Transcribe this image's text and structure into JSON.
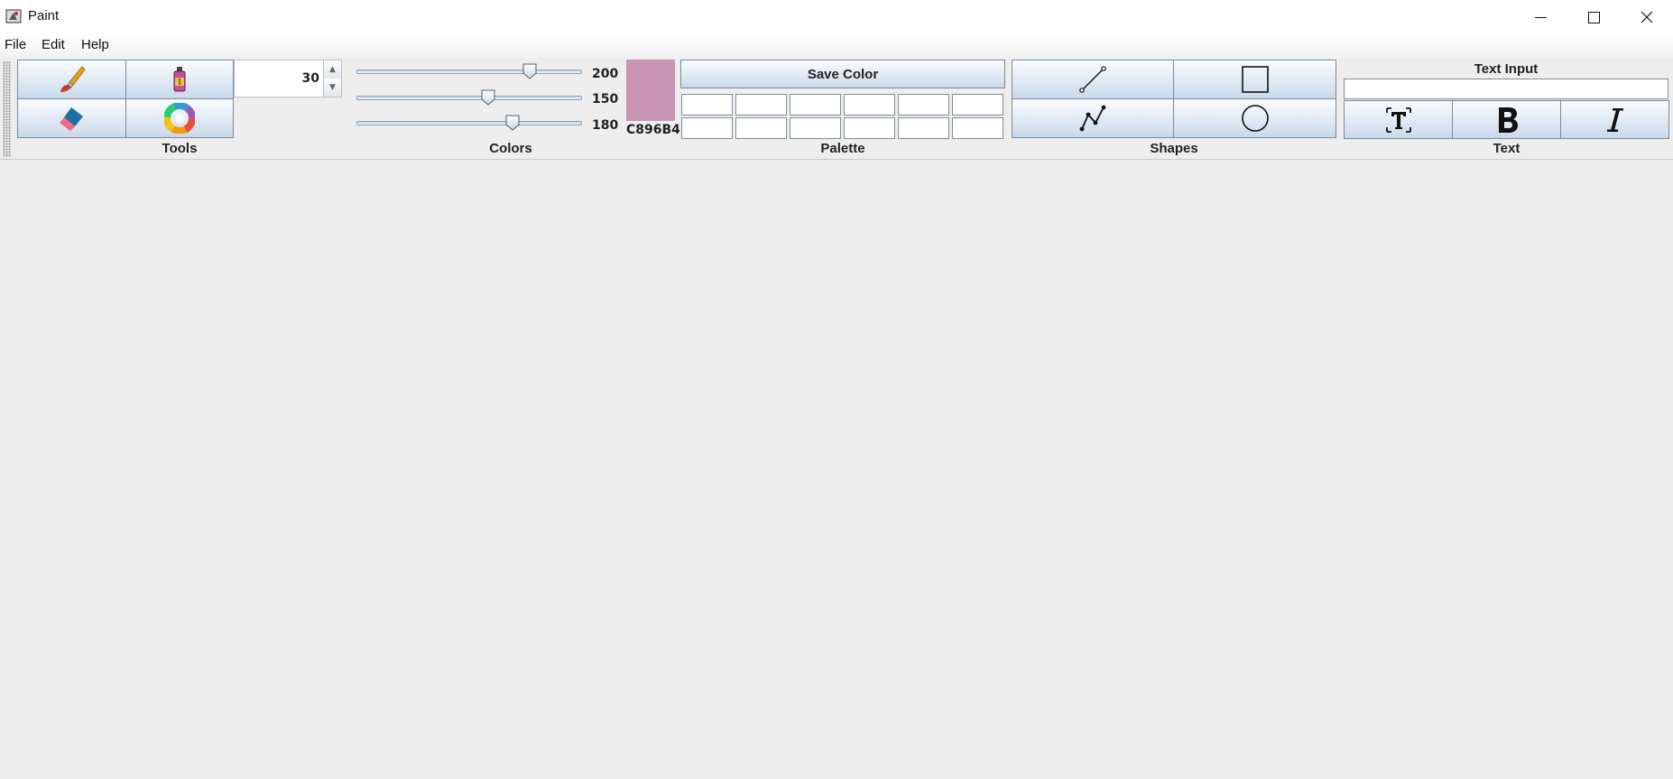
{
  "window": {
    "title": "Paint"
  },
  "menu": {
    "items": [
      "File",
      "Edit",
      "Help"
    ]
  },
  "tools": {
    "label": "Tools",
    "buttons": [
      "brush-icon",
      "spray-can-icon",
      "eraser-icon",
      "color-wheel-icon"
    ],
    "size_value": "30"
  },
  "colors": {
    "label": "Colors",
    "red": 200,
    "green": 150,
    "blue": 180,
    "slider_max": 255,
    "current_hex": "C896B4",
    "current_color": "#C896B4"
  },
  "palette": {
    "label": "Palette",
    "save_label": "Save Color",
    "cells": 12
  },
  "shapes": {
    "label": "Shapes",
    "buttons": [
      "line-icon",
      "rectangle-icon",
      "polyline-icon",
      "ellipse-icon"
    ]
  },
  "text": {
    "label": "Text",
    "input_label": "Text Input",
    "input_value": "",
    "buttons": [
      "text-tool-icon",
      "bold-icon",
      "italic-icon"
    ]
  }
}
